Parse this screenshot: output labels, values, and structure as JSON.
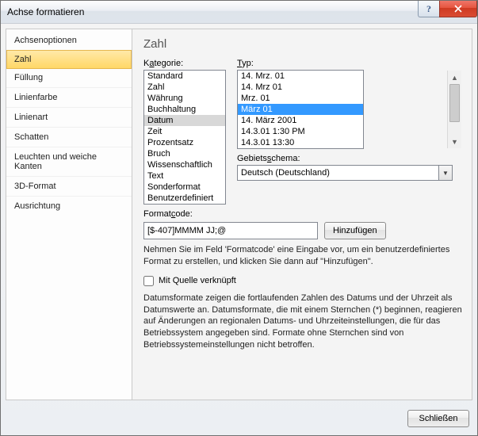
{
  "window": {
    "title": "Achse formatieren"
  },
  "sidebar": {
    "items": [
      {
        "label": "Achsenoptionen"
      },
      {
        "label": "Zahl"
      },
      {
        "label": "Füllung"
      },
      {
        "label": "Linienfarbe"
      },
      {
        "label": "Linienart"
      },
      {
        "label": "Schatten"
      },
      {
        "label": "Leuchten und weiche Kanten"
      },
      {
        "label": "3D-Format"
      },
      {
        "label": "Ausrichtung"
      }
    ],
    "selected": 1
  },
  "pane": {
    "heading": "Zahl",
    "category_lbl_pre": "K",
    "category_lbl_ul": "a",
    "category_lbl_post": "tegorie:",
    "categories": [
      "Standard",
      "Zahl",
      "Währung",
      "Buchhaltung",
      "Datum",
      "Zeit",
      "Prozentsatz",
      "Bruch",
      "Wissenschaftlich",
      "Text",
      "Sonderformat",
      "Benutzerdefiniert"
    ],
    "category_selected": 4,
    "type_lbl_ul": "T",
    "type_lbl_post": "yp:",
    "types": [
      "14. Mrz. 01",
      "14. Mrz 01",
      "Mrz. 01",
      "März 01",
      "14. März 2001",
      "14.3.01 1:30 PM",
      "14.3.01 13:30"
    ],
    "type_selected": 3,
    "locale_lbl_pre": "Gebiets",
    "locale_lbl_ul": "s",
    "locale_lbl_post": "chema:",
    "locale_value": "Deutsch (Deutschland)",
    "format_lbl_pre": "Format",
    "format_lbl_ul": "c",
    "format_lbl_post": "ode:",
    "format_value": "[$-407]MMMM JJ;@",
    "add_btn_pre": "Hin",
    "add_btn_ul": "z",
    "add_btn_post": "ufügen",
    "hint1": "Nehmen Sie im Feld 'Formatcode' eine Eingabe vor, um ein benutzerdefiniertes Format zu erstellen, und klicken Sie dann auf \"Hinzufügen\".",
    "linked_pre": "Mit ",
    "linked_ul": "Q",
    "linked_post": "uelle verknüpft",
    "hint2": "Datumsformate zeigen die fortlaufenden Zahlen des Datums und der Uhrzeit als Datumswerte an. Datumsformate, die mit einem Sternchen (*) beginnen, reagieren auf Änderungen an regionalen Datums- und Uhrzeiteinstellungen, die für das Betriebssystem angegeben sind. Formate ohne Sternchen sind von Betriebssystemeinstellungen nicht betroffen."
  },
  "footer": {
    "close": "Schließen"
  }
}
